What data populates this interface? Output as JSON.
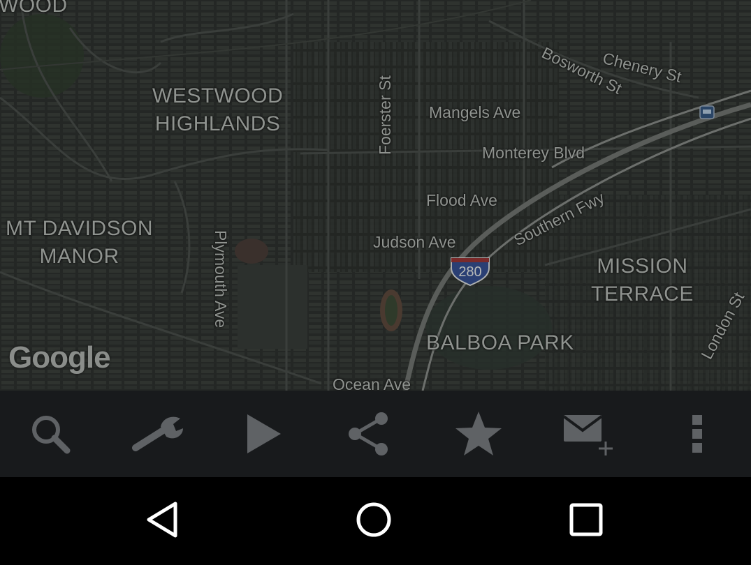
{
  "map": {
    "attribution": "Google",
    "neighborhoods": {
      "westwood_top": "WOOD",
      "westwood_highlands": "WESTWOOD\nHIGHLANDS",
      "mt_davidson": "MT DAVIDSON\nMANOR",
      "mission_terrace": "MISSION\nTERRACE",
      "balboa_park": "BALBOA PARK"
    },
    "streets": {
      "chenery": "Chenery St",
      "bosworth": "Bosworth St",
      "foerster": "Foerster St",
      "mangels": "Mangels Ave",
      "monterey": "Monterey Blvd",
      "flood": "Flood Ave",
      "southern_fwy": "Southern Fwy",
      "judson": "Judson Ave",
      "plymouth": "Plymouth Ave",
      "london": "London St",
      "ocean": "Ocean Ave"
    },
    "highway_shield": "280"
  },
  "toolbar": {
    "icon_color": "#5f6265",
    "buttons": [
      {
        "icon": "search-icon"
      },
      {
        "icon": "wrench-icon"
      },
      {
        "icon": "play-icon"
      },
      {
        "icon": "share-icon"
      },
      {
        "icon": "star-icon"
      },
      {
        "icon": "mail-add-icon"
      },
      {
        "icon": "more-vert-icon"
      }
    ]
  },
  "navbar": {
    "buttons": [
      {
        "icon": "back-icon"
      },
      {
        "icon": "home-icon"
      },
      {
        "icon": "recents-icon"
      }
    ]
  }
}
